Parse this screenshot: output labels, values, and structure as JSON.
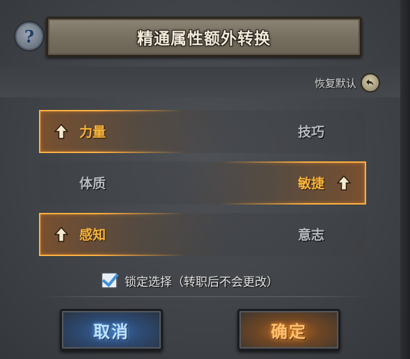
{
  "dialog": {
    "title": "精通属性额外转换",
    "help_glyph": "?",
    "reset_label": "恢复默认",
    "reset_icon": "undo-arrow-icon"
  },
  "attributes": {
    "rows": [
      {
        "left": {
          "label": "力量",
          "selected": true
        },
        "right": {
          "label": "技巧",
          "selected": false
        }
      },
      {
        "left": {
          "label": "体质",
          "selected": false
        },
        "right": {
          "label": "敏捷",
          "selected": true
        }
      },
      {
        "left": {
          "label": "感知",
          "selected": true
        },
        "right": {
          "label": "意志",
          "selected": false
        }
      }
    ],
    "selected_icon": "up-arrow-icon"
  },
  "lock": {
    "checked": true,
    "label": "锁定选择（转职后不会更改）"
  },
  "buttons": {
    "cancel_label": "取消",
    "confirm_label": "确定"
  },
  "colors": {
    "selected_text": "#f6b43c",
    "unselected_text": "#b8bcc4",
    "glow": "#ffb040",
    "cancel_accent": "#5aa8ff",
    "confirm_accent": "#ff9a30"
  }
}
